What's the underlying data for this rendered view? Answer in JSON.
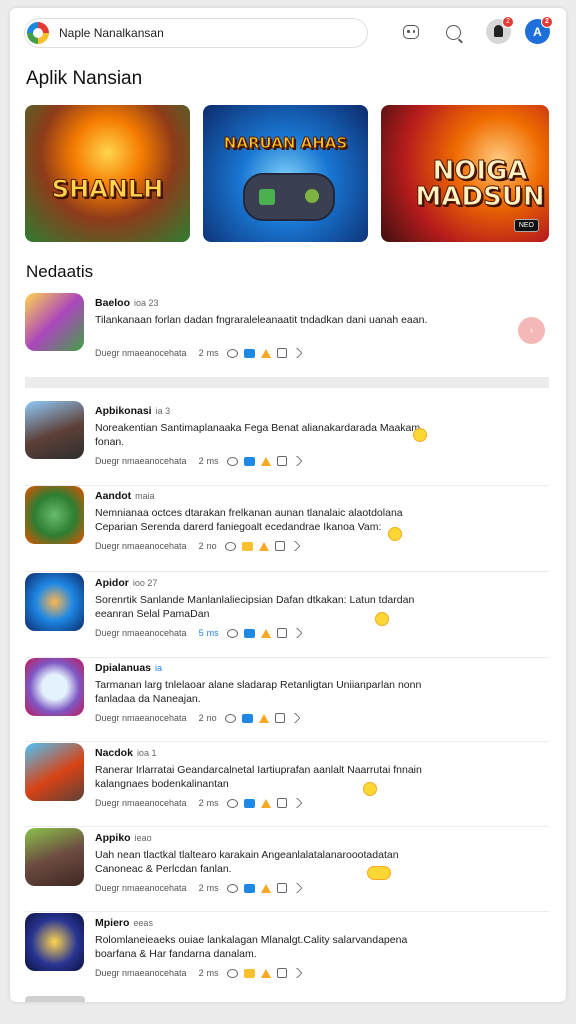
{
  "search": {
    "text": "Naple Nanalkansan"
  },
  "badges": {
    "avatar1": "2",
    "avatar2": "2"
  },
  "avatar2_letter": "A",
  "featured_section": {
    "title": "Aplik Nansian",
    "cards": [
      {
        "title": "SHANLH"
      },
      {
        "title": "NARUAN AHAS"
      },
      {
        "title": "NOIGA MADSUN",
        "tag": "NEO"
      }
    ]
  },
  "list_section": {
    "title": "Nedaatis"
  },
  "apps": [
    {
      "title": "Baeloo",
      "meta": "ioa 23",
      "desc": "Tilankanaan forlan dadan fngraraleleanaatit tndadkan dani uanah eaan.",
      "foot": "Duegr nmaeanocehata",
      "num": "2",
      "unit": "ms"
    },
    {
      "title": "Apbikonasi",
      "meta": "ia 3",
      "desc": "Noreakentian Santimaplanaaka Fega Benat alianakardarada Maakam fonan.",
      "foot": "Duegr nmaeanocehata",
      "num": "2",
      "unit": "ms"
    },
    {
      "title": "Aandot",
      "meta": "maia",
      "desc": "Nemnianaa octces dtarakan frelkanan aunan tlanalaic alaotdolana Ceparian Serenda darerd faniegoalt ecedandrae Ikanoa Vam:",
      "foot": "Duegr nmaeanocehata",
      "num": "2",
      "unit": "no"
    },
    {
      "title": "Apidor",
      "meta": "ioo 27",
      "desc": "Sorenrtik Sanlande Manlanlaliecipsian Dafan dtkakan: Latun tdardan eeanran Selal PamaDan",
      "foot": "Duegr nmaeanocehata",
      "num": "5",
      "unit": "ms"
    },
    {
      "title": "Dpialanuas",
      "meta": "ia",
      "desc": "Tarmanan larg tnlelaoar alane sladarap Retanligtan Uniianparlan nonn fanladaa da Naneajan.",
      "foot": "Duegr nmaeanocehata",
      "num": "2",
      "unit": "no"
    },
    {
      "title": "Nacdok",
      "meta": "ioa 1",
      "desc": "Ranerar Irlarratai Geandarcalnetal Iartiuprafan aanlalt Naarrutai fnnain kalangnaes bodenkalinantan",
      "foot": "Duegr nmaeanocehata",
      "num": "2",
      "unit": "ms"
    },
    {
      "title": "Appiko",
      "meta": "ieao",
      "desc": "Uah nean tlactkal tlaltearo karakain Angeanlalatalanaroootadatan Canoneac & Perlcdan fanlan.",
      "foot": "Duegr nmaeanocehata",
      "num": "2",
      "unit": "ms"
    },
    {
      "title": "Mpiero",
      "meta": "eeas",
      "desc": "Rolomlaneieaeks ouiae lankalagan Mlanalgt.Cality salarvandapena boarfana & Har fandarna danalam.",
      "foot": "Duegr nmaeanocehata",
      "num": "2",
      "unit": "ms"
    }
  ],
  "colors": {
    "accent_blue": "#1e6fd9",
    "badge_red": "#e53935",
    "star_yellow": "#f9a825"
  },
  "icons": [
    "robot-icon",
    "chat-search-icon",
    "profile-avatar-icon",
    "account-avatar-icon",
    "eye-icon",
    "chip-icon",
    "star-icon",
    "bag-icon",
    "share-icon",
    "emoji-icon"
  ]
}
